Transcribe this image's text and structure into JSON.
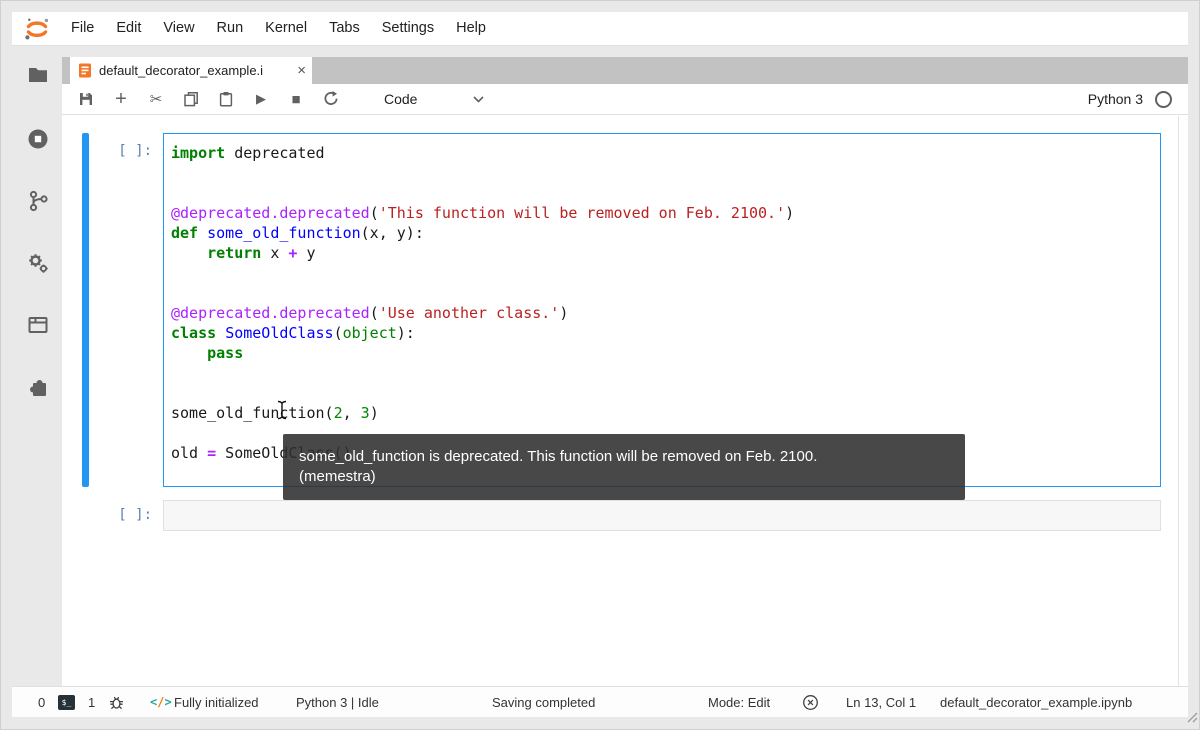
{
  "menubar": {
    "items": [
      "File",
      "Edit",
      "View",
      "Run",
      "Kernel",
      "Tabs",
      "Settings",
      "Help"
    ]
  },
  "tabbar": {
    "active_tab": {
      "title": "default_decorator_example.i",
      "close_label": "×"
    }
  },
  "toolbar": {
    "plus_label": "+",
    "cut_label": "✂",
    "run_label": "▶",
    "stop_label": "■",
    "celltype": "Code",
    "kernel_name": "Python 3"
  },
  "notebook": {
    "cells": [
      {
        "prompt": "[ ]:",
        "code_lines": [
          [
            {
              "c": "kw",
              "t": "import"
            },
            {
              "c": "",
              "t": " deprecated"
            }
          ],
          [],
          [],
          [
            {
              "c": "meta",
              "t": "@deprecated.deprecated"
            },
            {
              "c": "",
              "t": "("
            },
            {
              "c": "str",
              "t": "'This function will be removed on Feb. 2100.'"
            },
            {
              "c": "",
              "t": ")"
            }
          ],
          [
            {
              "c": "kw",
              "t": "def"
            },
            {
              "c": "",
              "t": " "
            },
            {
              "c": "df",
              "t": "some_old_function"
            },
            {
              "c": "",
              "t": "(x, y):"
            }
          ],
          [
            {
              "c": "",
              "t": "    "
            },
            {
              "c": "kw",
              "t": "return"
            },
            {
              "c": "",
              "t": " x "
            },
            {
              "c": "op",
              "t": "+"
            },
            {
              "c": "",
              "t": " y"
            }
          ],
          [],
          [],
          [
            {
              "c": "meta",
              "t": "@deprecated.deprecated"
            },
            {
              "c": "",
              "t": "("
            },
            {
              "c": "str",
              "t": "'Use another class.'"
            },
            {
              "c": "",
              "t": ")"
            }
          ],
          [
            {
              "c": "kw",
              "t": "class"
            },
            {
              "c": "",
              "t": " "
            },
            {
              "c": "df",
              "t": "SomeOldClass"
            },
            {
              "c": "",
              "t": "("
            },
            {
              "c": "bi",
              "t": "object"
            },
            {
              "c": "",
              "t": "):"
            }
          ],
          [
            {
              "c": "",
              "t": "    "
            },
            {
              "c": "kw",
              "t": "pass"
            }
          ],
          [],
          [],
          [
            {
              "c": "",
              "t": "some_old_function("
            },
            {
              "c": "num",
              "t": "2"
            },
            {
              "c": "",
              "t": ", "
            },
            {
              "c": "num",
              "t": "3"
            },
            {
              "c": "",
              "t": ")"
            }
          ],
          [],
          [
            {
              "c": "",
              "t": "old "
            },
            {
              "c": "op",
              "t": "="
            },
            {
              "c": "",
              "t": " SomeOldClass()"
            }
          ]
        ]
      },
      {
        "prompt": "[ ]:",
        "code_lines": []
      }
    ]
  },
  "tooltip": {
    "line1": "some_old_function is deprecated. This function will be removed on Feb. 2100.",
    "line2": "(memestra)"
  },
  "statusbar": {
    "kernels_count": "0",
    "terminal_glyph": "$_",
    "terminals_count": "1",
    "lsp_status": "Fully initialized",
    "kernel_status": "Python 3 | Idle",
    "saving": "Saving completed",
    "mode": "Mode: Edit",
    "cursor_pos": "Ln 13, Col 1",
    "filename": "default_decorator_example.ipynb"
  },
  "colors": {
    "accent_orange": "#f37726",
    "active_cell_blue": "#2196f3",
    "tooltip_bg": "#2f2f2f"
  }
}
